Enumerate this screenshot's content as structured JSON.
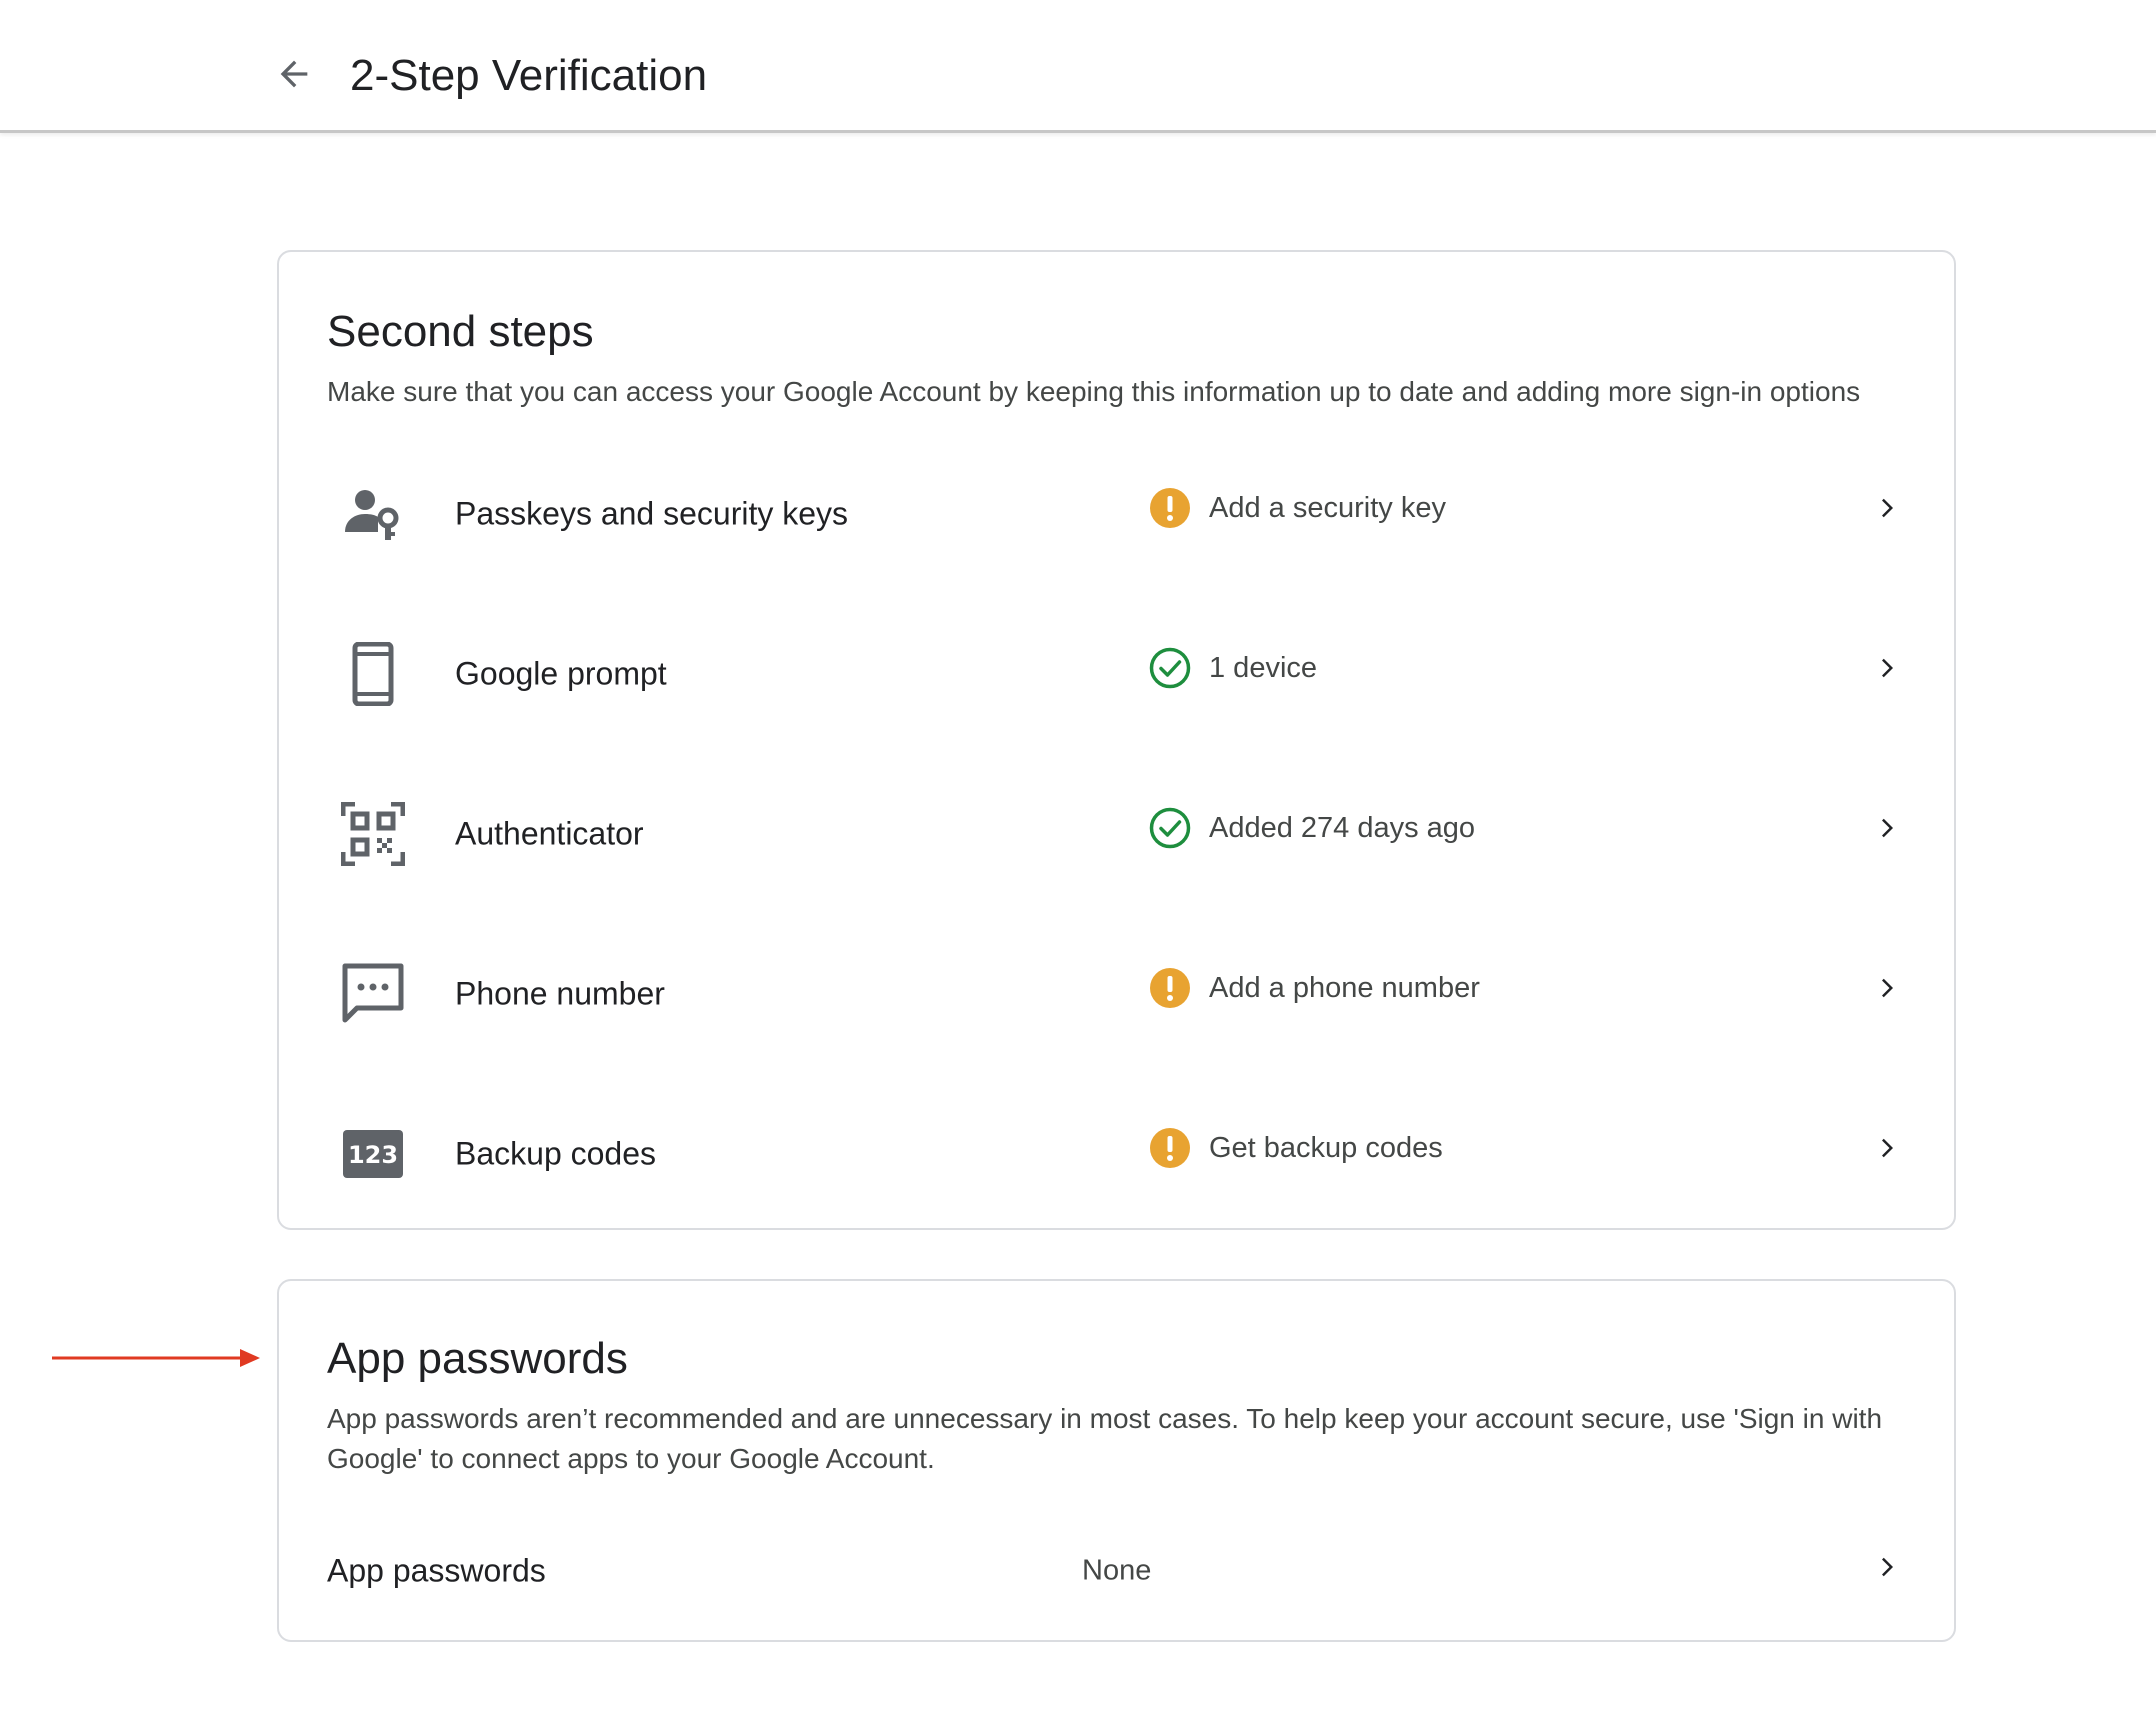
{
  "header": {
    "title": "2-Step Verification",
    "back_icon": "arrow-back-icon"
  },
  "second_steps": {
    "title": "Second steps",
    "description": "Make sure that you can access your Google Account by keeping this information up to date and adding more sign-in options",
    "items": [
      {
        "label": "Passkeys and security keys",
        "icon": "passkey-icon",
        "status_icon": "warning-icon",
        "status": "Add a security key"
      },
      {
        "label": "Google prompt",
        "icon": "phone-device-icon",
        "status_icon": "check-circle-icon",
        "status": "1 device"
      },
      {
        "label": "Authenticator",
        "icon": "qr-code-icon",
        "status_icon": "check-circle-icon",
        "status": "Added 274 days ago"
      },
      {
        "label": "Phone number",
        "icon": "sms-icon",
        "status_icon": "warning-icon",
        "status": "Add a phone number"
      },
      {
        "label": "Backup codes",
        "icon": "backup-codes-icon",
        "icon_text": "123",
        "status_icon": "warning-icon",
        "status": "Get backup codes"
      }
    ]
  },
  "app_passwords": {
    "title": "App passwords",
    "description": "App passwords aren’t recommended and are unnecessary in most cases. To help keep your account secure, use 'Sign in with Google' to connect apps to your Google Account.",
    "row_label": "App passwords",
    "row_value": "None"
  },
  "colors": {
    "warning": "#e8a331",
    "success": "#1e8e3e",
    "icon_gray": "#5f6368",
    "annotation_arrow": "#e03a22"
  }
}
